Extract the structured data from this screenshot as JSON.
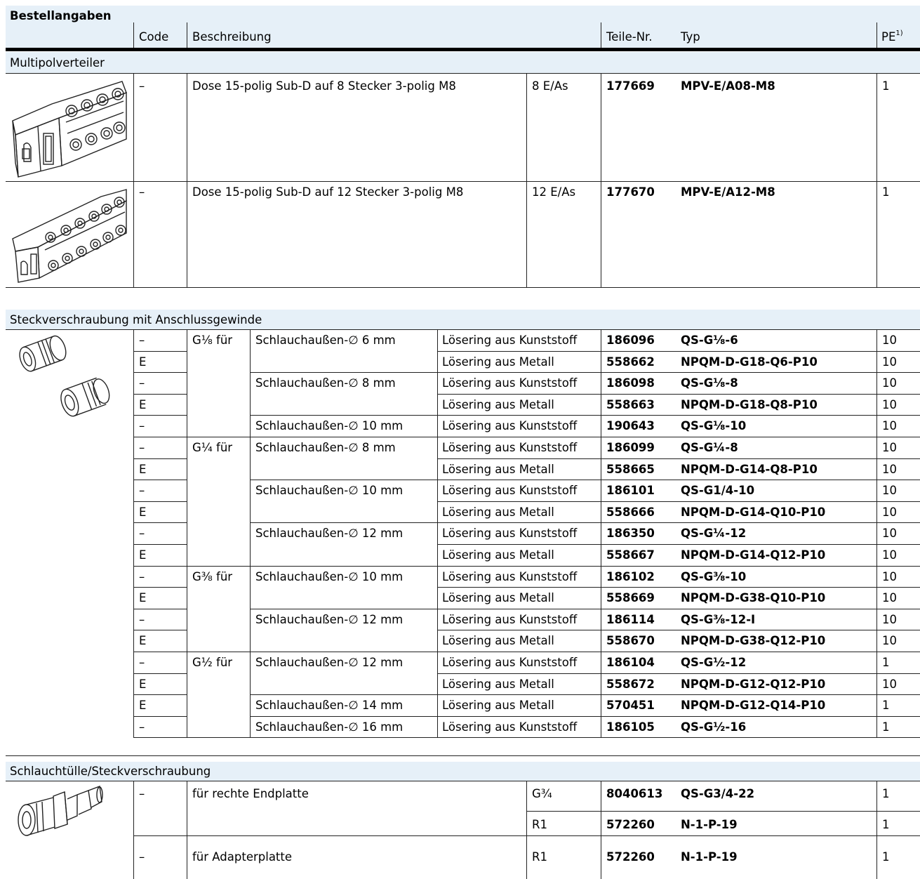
{
  "title": "Bestellangaben",
  "header": {
    "code": "Code",
    "beschreibung": "Beschreibung",
    "teile": "Teile-Nr.",
    "typ": "Typ",
    "pe": "PE",
    "pe_sup": "1)"
  },
  "multipol": {
    "section": "Multipolverteiler",
    "rows": [
      {
        "code": "–",
        "desc": "Dose 15-polig Sub-D auf 8 Stecker 3-polig M8",
        "io": "8 E/As",
        "part": "177669",
        "type": "MPV-E/A08-M8",
        "pe": "1"
      },
      {
        "code": "–",
        "desc": "Dose 15-polig Sub-D auf 12 Stecker 3-polig M8",
        "io": "12 E/As",
        "part": "177670",
        "type": "MPV-E/A12-M8",
        "pe": "1"
      }
    ]
  },
  "steck": {
    "section": "Steckverschraubung mit Anschlussgewinde",
    "threads": [
      "G⅛ für",
      "G¼ für",
      "G⅜ für",
      "G½ für"
    ],
    "hoses": [
      "Schlauchaußen-∅ 6 mm",
      "Schlauchaußen-∅ 8 mm",
      "Schlauchaußen-∅ 10 mm",
      "Schlauchaußen-∅ 8 mm",
      "Schlauchaußen-∅ 10 mm",
      "Schlauchaußen-∅ 12 mm",
      "Schlauchaußen-∅ 10 mm",
      "Schlauchaußen-∅ 12 mm",
      "Schlauchaußen-∅ 12 mm",
      "Schlauchaußen-∅ 14 mm",
      "Schlauchaußen-∅ 16 mm"
    ],
    "rows": [
      {
        "code": "–",
        "ring": "Lösering aus Kunststoff",
        "part": "186096",
        "type": "QS-G⅛-6",
        "pe": "10"
      },
      {
        "code": "E",
        "ring": "Lösering aus Metall",
        "part": "558662",
        "type": "NPQM-D-G18-Q6-P10",
        "pe": "10"
      },
      {
        "code": "–",
        "ring": "Lösering aus Kunststoff",
        "part": "186098",
        "type": "QS-G⅛-8",
        "pe": "10"
      },
      {
        "code": "E",
        "ring": "Lösering aus Metall",
        "part": "558663",
        "type": "NPQM-D-G18-Q8-P10",
        "pe": "10"
      },
      {
        "code": "–",
        "ring": "Lösering aus Kunststoff",
        "part": "190643",
        "type": "QS-G⅛-10",
        "pe": "10"
      },
      {
        "code": "–",
        "ring": "Lösering aus Kunststoff",
        "part": "186099",
        "type": "QS-G¼-8",
        "pe": "10"
      },
      {
        "code": "E",
        "ring": "Lösering aus Metall",
        "part": "558665",
        "type": "NPQM-D-G14-Q8-P10",
        "pe": "10"
      },
      {
        "code": "–",
        "ring": "Lösering aus Kunststoff",
        "part": "186101",
        "type": "QS-G1/4-10",
        "pe": "10"
      },
      {
        "code": "E",
        "ring": "Lösering aus Metall",
        "part": "558666",
        "type": "NPQM-D-G14-Q10-P10",
        "pe": "10"
      },
      {
        "code": "–",
        "ring": "Lösering aus Kunststoff",
        "part": "186350",
        "type": "QS-G¼-12",
        "pe": "10"
      },
      {
        "code": "E",
        "ring": "Lösering aus Metall",
        "part": "558667",
        "type": "NPQM-D-G14-Q12-P10",
        "pe": "10"
      },
      {
        "code": "–",
        "ring": "Lösering aus Kunststoff",
        "part": "186102",
        "type": "QS-G⅜-10",
        "pe": "10"
      },
      {
        "code": "E",
        "ring": "Lösering aus Metall",
        "part": "558669",
        "type": "NPQM-D-G38-Q10-P10",
        "pe": "10"
      },
      {
        "code": "–",
        "ring": "Lösering aus Kunststoff",
        "part": "186114",
        "type": "QS-G⅜-12-I",
        "pe": "10"
      },
      {
        "code": "E",
        "ring": "Lösering aus Metall",
        "part": "558670",
        "type": "NPQM-D-G38-Q12-P10",
        "pe": "10"
      },
      {
        "code": "–",
        "ring": "Lösering aus Kunststoff",
        "part": "186104",
        "type": "QS-G½-12",
        "pe": "1"
      },
      {
        "code": "E",
        "ring": "Lösering aus Metall",
        "part": "558672",
        "type": "NPQM-D-G12-Q12-P10",
        "pe": "10"
      },
      {
        "code": "E",
        "ring": "Lösering aus Metall",
        "part": "570451",
        "type": "NPQM-D-G12-Q14-P10",
        "pe": "1"
      },
      {
        "code": "–",
        "ring": "Lösering aus Kunststoff",
        "part": "186105",
        "type": "QS-G½-16",
        "pe": "1"
      }
    ]
  },
  "tuelle": {
    "section": "Schlauchtülle/Steckverschraubung",
    "desc1": "für rechte Endplatte",
    "desc2": "für Adapterplatte",
    "rows": [
      {
        "code": "–",
        "thread": "G¾",
        "part": "8040613",
        "type": "QS-G3/4-22",
        "pe": "1"
      },
      {
        "code": "",
        "thread": "R1",
        "part": "572260",
        "type": "N-1-P-19",
        "pe": "1"
      },
      {
        "code": "–",
        "thread": "R1",
        "part": "572260",
        "type": "N-1-P-19",
        "pe": "1"
      }
    ]
  }
}
